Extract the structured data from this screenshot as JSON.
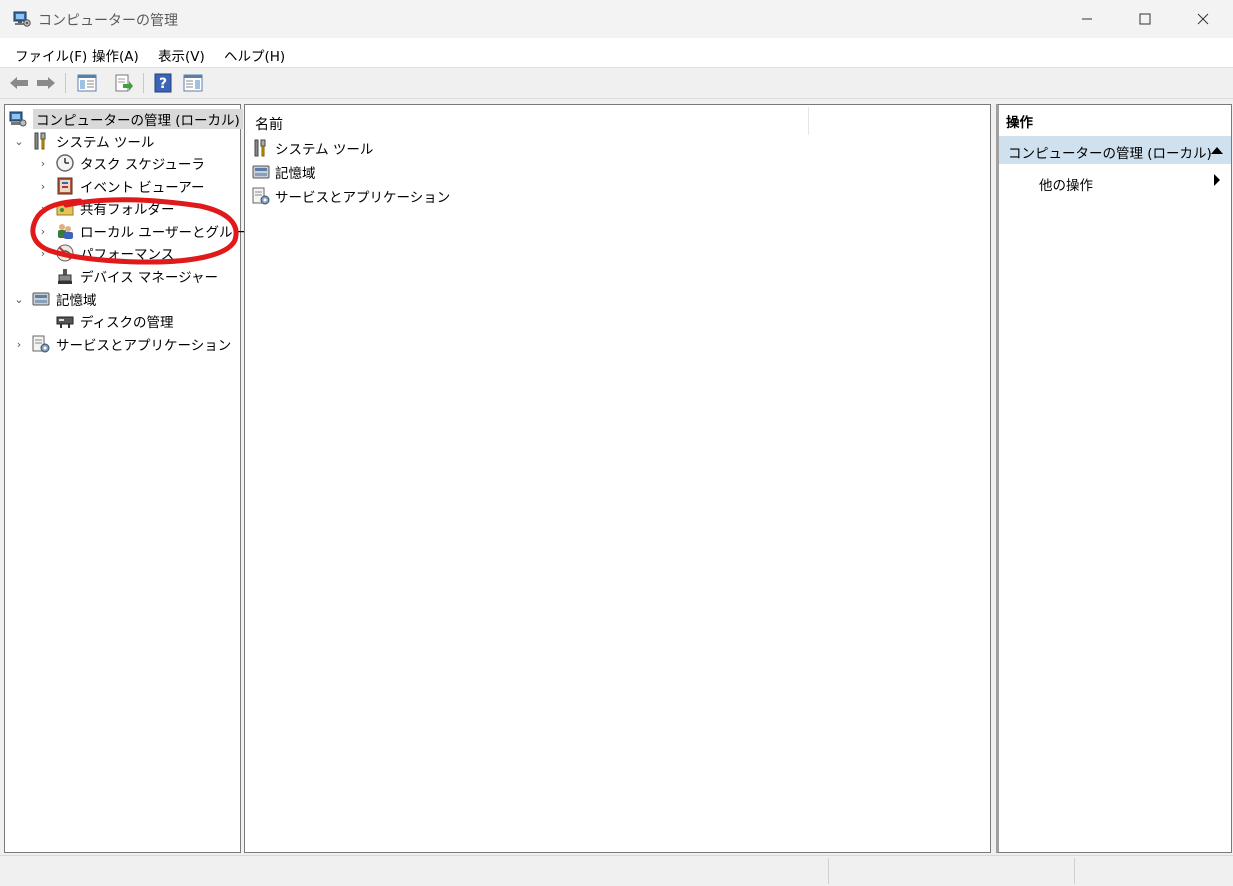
{
  "window": {
    "title": "コンピューターの管理",
    "minimize_icon": "minimize-icon",
    "maximize_icon": "maximize-icon",
    "close_icon": "close-icon"
  },
  "menu": [
    "ファイル(F)",
    "操作(A)",
    "表示(V)",
    "ヘルプ(H)"
  ],
  "toolbar": [
    "back-arrow-icon",
    "forward-arrow-icon",
    "show-hide-console-tree-icon",
    "export-list-icon",
    "help-icon",
    "show-hide-action-pane-icon"
  ],
  "tree": {
    "root": "コンピューターの管理 (ローカル)",
    "system_tools": "システム ツール",
    "task_scheduler": "タスク スケジューラ",
    "event_viewer": "イベント ビューアー",
    "shared_folders": "共有フォルダー",
    "local_users": "ローカル ユーザーとグループ",
    "performance": "パフォーマンス",
    "device_manager": "デバイス マネージャー",
    "storage": "記憶域",
    "disk_management": "ディスクの管理",
    "services_apps": "サービスとアプリケーション"
  },
  "list": {
    "column_name": "名前",
    "rows": [
      "システム ツール",
      "記憶域",
      "サービスとアプリケーション"
    ]
  },
  "actions": {
    "header": "操作",
    "selected": "コンピューターの管理 (ローカル)",
    "more": "他の操作"
  },
  "colors": {
    "selection_bg": "#cfe0ef",
    "annotation": "#e01a1a"
  }
}
